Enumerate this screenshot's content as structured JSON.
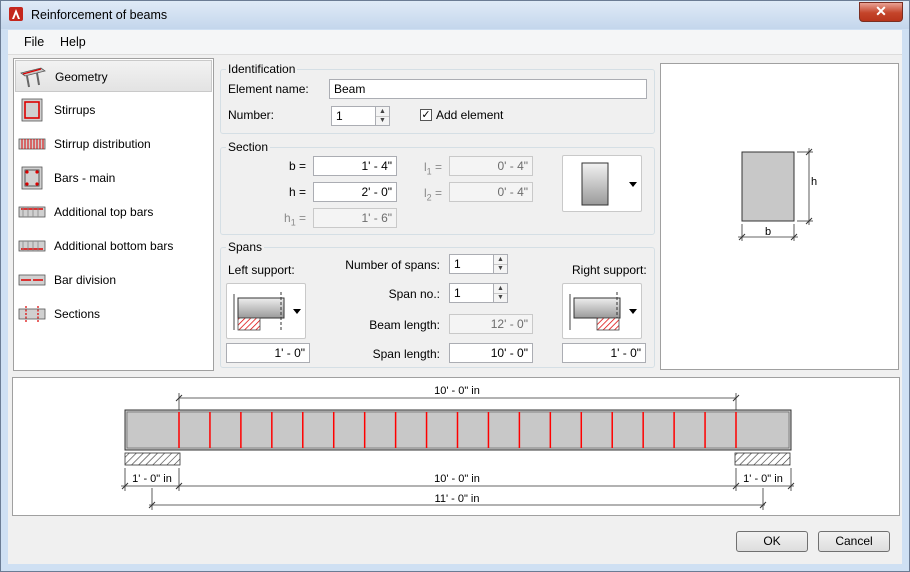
{
  "window": {
    "title": "Reinforcement of beams",
    "close_glyph": "✕"
  },
  "menu": {
    "file": "File",
    "help": "Help"
  },
  "nav": {
    "items": [
      {
        "label": "Geometry",
        "icon": "geometry-icon"
      },
      {
        "label": "Stirrups",
        "icon": "stirrups-icon"
      },
      {
        "label": "Stirrup distribution",
        "icon": "stirrup-distribution-icon"
      },
      {
        "label": "Bars - main",
        "icon": "bars-main-icon"
      },
      {
        "label": "Additional top bars",
        "icon": "additional-top-bars-icon"
      },
      {
        "label": "Additional bottom bars",
        "icon": "additional-bottom-bars-icon"
      },
      {
        "label": "Bar division",
        "icon": "bar-division-icon"
      },
      {
        "label": "Sections",
        "icon": "sections-icon"
      }
    ]
  },
  "identification": {
    "title": "Identification",
    "element_name_label": "Element name:",
    "element_name_value": "Beam",
    "number_label": "Number:",
    "number_value": "1",
    "add_element_label": "Add element",
    "add_element_checked": true
  },
  "section": {
    "title": "Section",
    "b_label": "b =",
    "b_value": "1' - 4\"",
    "h_label": "h =",
    "h_value": "2' - 0\"",
    "h1_label": "h",
    "h1_sub": "1",
    "h1_eq": "=",
    "h1_value": "1' - 6\"",
    "l1_label": "l",
    "l1_sub": "1",
    "l1_eq": "=",
    "l1_value": "0' - 4\"",
    "l2_label": "l",
    "l2_sub": "2",
    "l2_eq": "=",
    "l2_value": "0' - 4\""
  },
  "spans": {
    "title": "Spans",
    "left_support_label": "Left support:",
    "right_support_label": "Right support:",
    "number_of_spans_label": "Number of spans:",
    "number_of_spans_value": "1",
    "span_no_label": "Span no.:",
    "span_no_value": "1",
    "beam_length_label": "Beam length:",
    "beam_length_value": "12' - 0\"",
    "span_length_label": "Span length:",
    "span_length_value": "10' - 0\"",
    "left_support_value": "1' - 0\"",
    "right_support_value": "1' - 0\""
  },
  "preview": {
    "b_label": "b",
    "h_label": "h"
  },
  "elevation": {
    "top_dim": "10' - 0\" in",
    "span_dim": "10' - 0\" in",
    "left_support_dim": "1' - 0\" in",
    "right_support_dim": "1' - 0\" in",
    "total_dim": "11' - 0\" in",
    "stirrup_count": 19,
    "stirrup_color": "#ff0000"
  },
  "buttons": {
    "ok": "OK",
    "cancel": "Cancel"
  },
  "colors": {
    "accent": "#c4442a",
    "stirrup": "#ff0000",
    "concrete": "#c8c8c8"
  }
}
